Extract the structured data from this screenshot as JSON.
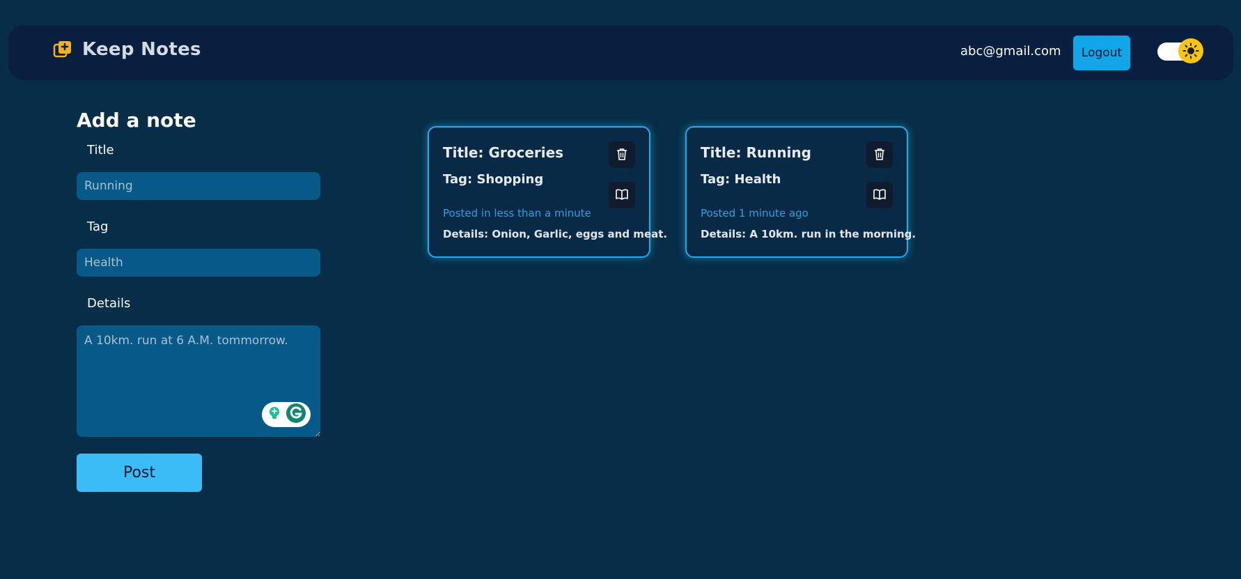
{
  "navbar": {
    "brand_title": "Keep Notes",
    "brand_icon": "note-plus-icon",
    "user_email": "abc@gmail.com",
    "logout_label": "Logout",
    "theme_icon": "sun-icon"
  },
  "add_note": {
    "heading": "Add a note",
    "title_label": "Title",
    "title_value": "Running",
    "tag_label": "Tag",
    "tag_value": "Health",
    "details_label": "Details",
    "details_value": "A 10km. run at 6 A.M. tommorrow.",
    "post_label": "Post"
  },
  "notes": [
    {
      "title": "Title: Groceries",
      "tag": "Tag: Shopping",
      "posted": "Posted in less than a minute",
      "details": "Details: Onion, Garlic, eggs and meat."
    },
    {
      "title": "Title: Running",
      "tag": "Tag: Health",
      "posted": "Posted 1 minute ago",
      "details": "Details: A 10km. run in the morning."
    }
  ],
  "colors": {
    "background": "#072d47",
    "navbar": "#081f40",
    "accent": "#10a6e8",
    "brand_icon": "#f0b41c"
  }
}
